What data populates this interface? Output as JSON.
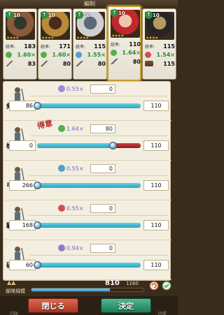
{
  "header": {
    "title": "編制"
  },
  "commanders": [
    {
      "level": "10",
      "stars": "★★★★",
      "troops_label": "統率:",
      "troops": "183",
      "multiplier": "1.60×",
      "attack": "83",
      "selected": false,
      "palette": [
        "#8b5a3c",
        "#2e3a2a"
      ]
    },
    {
      "level": "10",
      "stars": "★★★★",
      "troops_label": "統率:",
      "troops": "171",
      "multiplier": "1.60×",
      "attack": "80",
      "selected": false,
      "palette": [
        "#b88a3a",
        "#4a2a1a"
      ]
    },
    {
      "level": "10",
      "stars": "★★★★",
      "troops_label": "統率:",
      "troops": "115",
      "multiplier": "1.55×",
      "attack": "80",
      "selected": false,
      "palette": [
        "#cfcfcf",
        "#5a6a7a"
      ]
    },
    {
      "level": "10",
      "stars": "★★★★",
      "troops_label": "統率:",
      "troops": "110",
      "multiplier": "1.64×",
      "attack": "80",
      "selected": true,
      "palette": [
        "#c0282b",
        "#efc7b0"
      ]
    },
    {
      "level": "10",
      "stars": "★★★★",
      "troops_label": "統率:",
      "troops": "115",
      "multiplier": "1.54×",
      "attack": "115",
      "selected": false,
      "palette": [
        "#262626",
        "#b89a60"
      ]
    }
  ],
  "units": [
    {
      "name": "剣兵",
      "multiplier": "0.55×",
      "allocated": "0",
      "available": "86",
      "max": "110",
      "fill": 0.0,
      "color": "#9c8be0",
      "stamp": ""
    },
    {
      "name": "槍兵",
      "multiplier": "1.64×",
      "allocated": "80",
      "available": "0",
      "max": "110",
      "fill": 0.727,
      "color": "#4fb04a",
      "stamp": "得意"
    },
    {
      "name": "弓兵",
      "multiplier": "0.55×",
      "allocated": "0",
      "available": "266",
      "max": "110",
      "fill": 0.0,
      "color": "#4f9fd0",
      "stamp": ""
    },
    {
      "name": "騎馬兵",
      "multiplier": "0.55×",
      "allocated": "0",
      "available": "168",
      "max": "110",
      "fill": 0.0,
      "color": "#d05050",
      "stamp": ""
    },
    {
      "name": "破城兵",
      "multiplier": "0.94×",
      "allocated": "0",
      "available": "60",
      "max": "110",
      "fill": 0.0,
      "color": "#8a7ad0",
      "stamp": ""
    }
  ],
  "footer": {
    "scale_label": "部隊規模",
    "used": "810",
    "capacity": "1160",
    "fill": 0.698,
    "close_label": "閉じる",
    "confirm_label": "決定",
    "left_hint": "内政",
    "right_hint": "同盟"
  }
}
